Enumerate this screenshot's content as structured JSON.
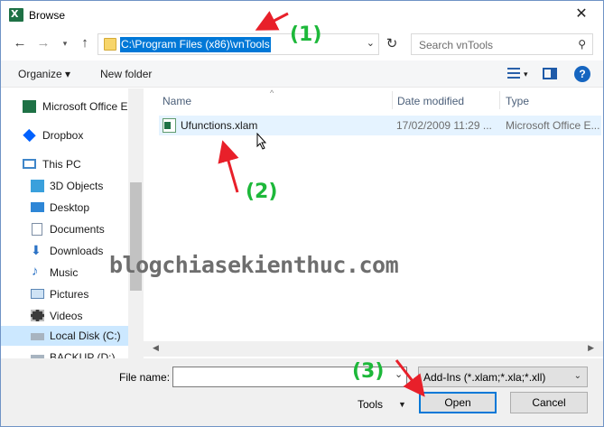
{
  "window": {
    "title": "Browse",
    "close_glyph": "✕"
  },
  "address_bar": {
    "path": "C:\\Program Files (x86)\\vnTools",
    "search_placeholder": "Search vnTools"
  },
  "toolbar": {
    "organize": "Organize ▾",
    "new_folder": "New folder"
  },
  "sidebar": {
    "items": [
      {
        "label": "Microsoft Office E",
        "icon": "excel-icon"
      },
      {
        "label": "Dropbox",
        "icon": "dropbox-icon"
      },
      {
        "label": "This PC",
        "icon": "pc-icon"
      },
      {
        "label": "3D Objects",
        "icon": "cube-icon"
      },
      {
        "label": "Desktop",
        "icon": "desktop-icon"
      },
      {
        "label": "Documents",
        "icon": "documents-icon"
      },
      {
        "label": "Downloads",
        "icon": "download-icon"
      },
      {
        "label": "Music",
        "icon": "music-icon"
      },
      {
        "label": "Pictures",
        "icon": "pictures-icon"
      },
      {
        "label": "Videos",
        "icon": "videos-icon"
      },
      {
        "label": "Local Disk (C:)",
        "icon": "drive-icon"
      },
      {
        "label": "BACKUP (D:)",
        "icon": "drive-icon"
      }
    ]
  },
  "file_list": {
    "columns": {
      "name": "Name",
      "date": "Date modified",
      "type": "Type"
    },
    "files": [
      {
        "name": "Ufunctions.xlam",
        "date": "17/02/2009 11:29 ...",
        "type": "Microsoft Office E..."
      }
    ]
  },
  "bottom": {
    "file_name_label": "File name:",
    "file_name_value": "",
    "filter": "Add-Ins (*.xlam;*.xla;*.xll)",
    "tools": "Tools",
    "open": "Open",
    "cancel": "Cancel"
  },
  "annotations": {
    "step1": "(1)",
    "step2": "(2)",
    "step3": "(3)"
  },
  "watermark": "blogchiasekienthuc.com",
  "colors": {
    "selection": "#0078d7",
    "annotation_green": "#1db83a",
    "annotation_red": "#e8202a"
  }
}
